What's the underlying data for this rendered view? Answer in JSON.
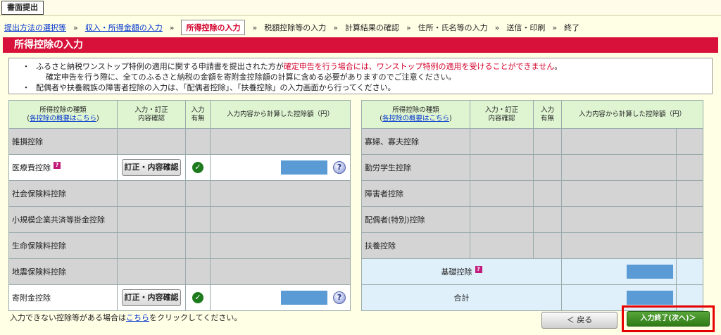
{
  "header": {
    "title_tab": "書面提出"
  },
  "steps": [
    {
      "label": "提出方法の選択等",
      "state": "link"
    },
    {
      "label": "収入・所得金額の入力",
      "state": "link"
    },
    {
      "label": "所得控除の入力",
      "state": "current"
    },
    {
      "label": "税額控除等の入力",
      "state": "plain"
    },
    {
      "label": "計算結果の確認",
      "state": "plain"
    },
    {
      "label": "住所・氏名等の入力",
      "state": "plain"
    },
    {
      "label": "送信・印刷",
      "state": "plain"
    },
    {
      "label": "終了",
      "state": "plain"
    }
  ],
  "step_separator": "»",
  "section_title": "所得控除の入力",
  "notice": {
    "line1_prefix": "ふるさと納税ワンストップ特例の適用に関する申請書を提出された方が",
    "line1_red": "確定申告を行う場合には、ワンストップ特例の適用を受けることができません",
    "line1_suffix": "。",
    "line2": "確定申告を行う際に、全てのふるさと納税の金額を寄附金控除額の計算に含める必要がありますのでご注意ください。",
    "line3": "配偶者や扶養親族の障害者控除の入力は、「配偶者控除」、「扶養控除」の入力画面から行ってください。",
    "bullet": "・"
  },
  "table_headers": {
    "kind": "所得控除の種類",
    "kind_link": "各控除の概要はこちら",
    "edit": "入力・訂正\n内容確認",
    "has_input": "入力\n有無",
    "amount": "入力内容から計算した控除額（円）"
  },
  "left_rows": [
    {
      "label": "雑損控除",
      "help": false,
      "button": "",
      "checked": false,
      "amount": false
    },
    {
      "label": "医療費控除",
      "help": true,
      "button": "訂正・内容確認",
      "checked": true,
      "amount": true
    },
    {
      "label": "社会保険料控除",
      "help": false,
      "button": "",
      "checked": false,
      "amount": false
    },
    {
      "label": "小規模企業共済等掛金控除",
      "help": false,
      "button": "",
      "checked": false,
      "amount": false
    },
    {
      "label": "生命保険料控除",
      "help": false,
      "button": "",
      "checked": false,
      "amount": false
    },
    {
      "label": "地震保険料控除",
      "help": false,
      "button": "",
      "checked": false,
      "amount": false
    },
    {
      "label": "寄附金控除",
      "help": false,
      "button": "訂正・内容確認",
      "checked": true,
      "amount": true
    }
  ],
  "right_rows": [
    {
      "label": "寡婦、寡夫控除"
    },
    {
      "label": "勤労学生控除"
    },
    {
      "label": "障害者控除"
    },
    {
      "label": "配偶者(特別)控除"
    },
    {
      "label": "扶養控除"
    }
  ],
  "right_summary": {
    "basic_label": "基礎控除",
    "total_label": "合計"
  },
  "help_mark": "?",
  "question_icon": "?",
  "check_mark": "✓",
  "bottom_note": {
    "prefix": "入力できない控除等がある場合は",
    "link": "こちら",
    "suffix": "をクリックしてください。"
  },
  "buttons": {
    "back": "＜ 戻る",
    "next": "入力終了(次へ)＞"
  },
  "colors": {
    "accent_red": "#d8113a",
    "header_green": "#dff5d2",
    "next_green": "#3d8f22",
    "amount_blue": "#5b9bd5"
  }
}
